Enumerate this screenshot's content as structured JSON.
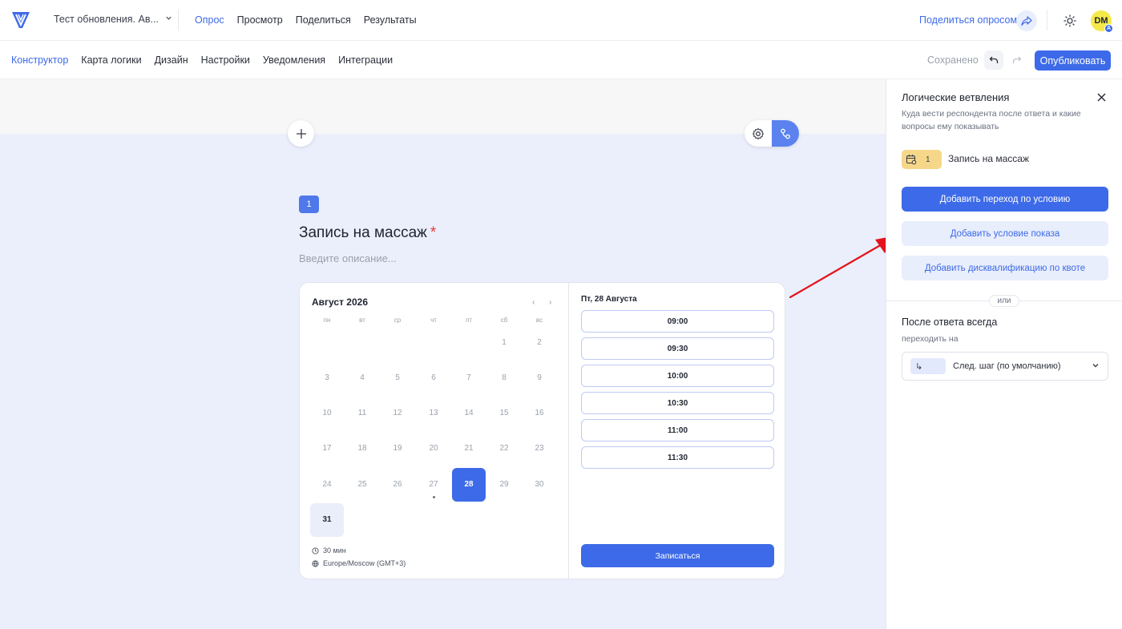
{
  "header": {
    "survey_title": "Тест обновления. Ав...",
    "nav": [
      "Опрос",
      "Просмотр",
      "Поделиться",
      "Результаты"
    ],
    "active_nav": "Опрос",
    "share_link": "Поделиться опросом",
    "avatar_initials": "DM",
    "avatar_badge": "A"
  },
  "toolbar": {
    "tabs": [
      "Конструктор",
      "Карта логики",
      "Дизайн",
      "Настройки",
      "Уведомления",
      "Интеграции"
    ],
    "active_tab": "Конструктор",
    "saved_label": "Сохранено",
    "publish_label": "Опубликовать"
  },
  "question": {
    "number": "1",
    "title": "Запись на массаж",
    "required_mark": "*",
    "description_placeholder": "Введите описание..."
  },
  "calendar": {
    "month_label": "Август 2026",
    "prev": "‹",
    "next": "›",
    "weekdays": [
      "пн",
      "вт",
      "ср",
      "чт",
      "пт",
      "сб",
      "вс"
    ],
    "weeks": [
      [
        "",
        "",
        "",
        "",
        "",
        "1",
        "2"
      ],
      [
        "3",
        "4",
        "5",
        "6",
        "7",
        "8",
        "9"
      ],
      [
        "10",
        "11",
        "12",
        "13",
        "14",
        "15",
        "16"
      ],
      [
        "17",
        "18",
        "19",
        "20",
        "21",
        "22",
        "23"
      ],
      [
        "24",
        "25",
        "26",
        "27",
        "28",
        "29",
        "30"
      ],
      [
        "31",
        "",
        "",
        "",
        "",
        "",
        ""
      ]
    ],
    "selected_day": "28",
    "available_days": [
      "31"
    ],
    "duration": "30 мин",
    "timezone": "Europe/Moscow (GMT+3)"
  },
  "slots": {
    "date_label": "Пт, 28 Августа",
    "times": [
      "09:00",
      "09:30",
      "10:00",
      "10:30",
      "11:00",
      "11:30"
    ],
    "book_label": "Записаться"
  },
  "logic_panel": {
    "title": "Логические ветвления",
    "subtitle": "Куда вести респондента после ответа и какие вопросы ему показывать",
    "question_number": "1",
    "question_name": "Запись на массаж",
    "btn_add_transition": "Добавить переход по условию",
    "btn_add_display": "Добавить условие показа",
    "btn_add_disqualify": "Добавить дисквалификацию по квоте",
    "or_label": "или",
    "after_title": "После ответа всегда",
    "after_sub": "переходить на",
    "after_select_icon": "↳",
    "after_select_value": "След. шаг (по умолчанию)"
  },
  "colors": {
    "accent": "#3d6ae8",
    "canvas": "#ebeffc",
    "arrow": "#e3131b",
    "chip": "#f6d78a",
    "avatar": "#f5e94a"
  }
}
